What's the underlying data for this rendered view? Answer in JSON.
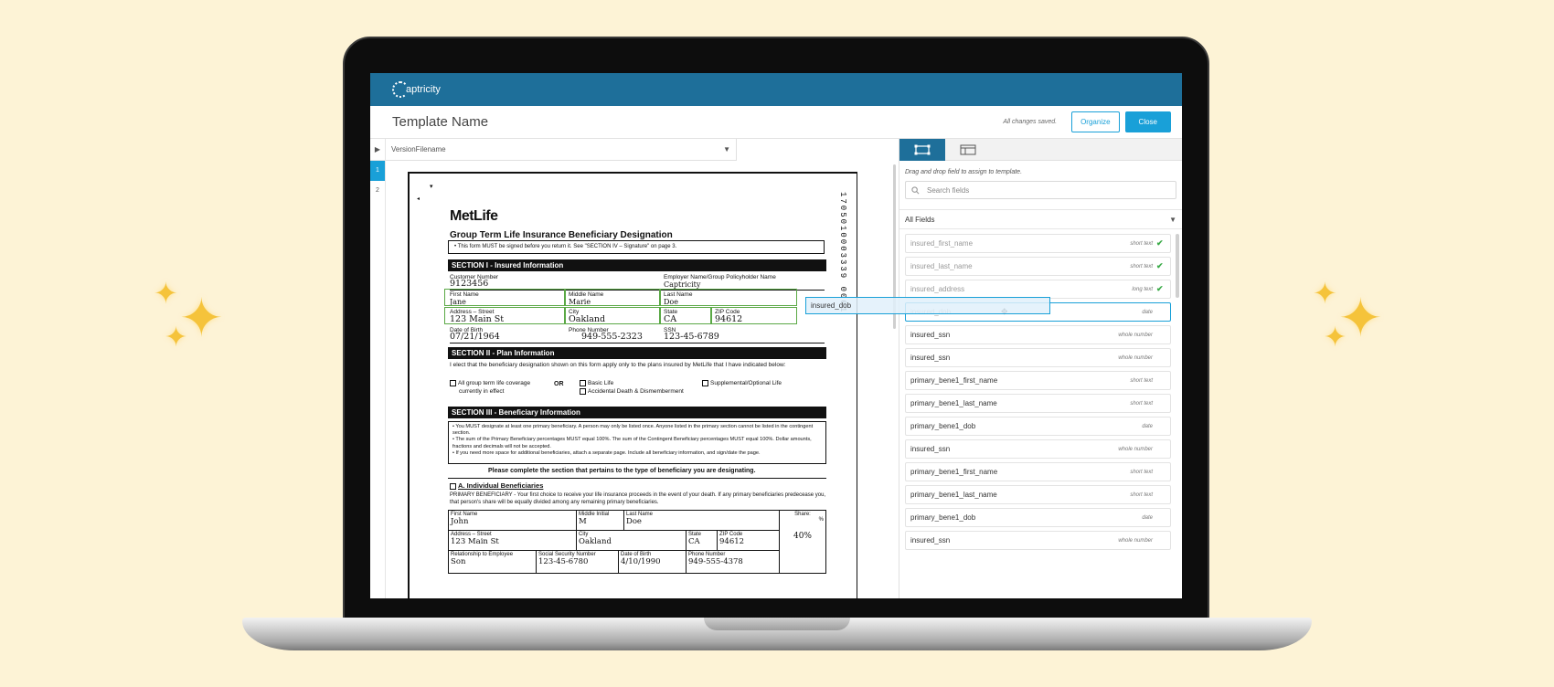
{
  "app": {
    "logo_text": "aptricity",
    "page_title": "Template Name",
    "save_status": "All changes saved.",
    "organize_label": "Organize",
    "close_label": "Close"
  },
  "document": {
    "version_filename": "VersionFilename",
    "pages": [
      "1",
      "2"
    ],
    "active_page": "1",
    "barcode": "1705010003339 0001",
    "form": {
      "company": "MetLife",
      "title": "Group Term Life Insurance Beneficiary Designation",
      "notice": "• This form MUST be signed before you return it. See \"SECTION IV – Signature\" on page 3.",
      "section1": "SECTION I - Insured Information",
      "customer_number_label": "Customer Number",
      "customer_number": "9123456",
      "employer_label": "Employer Name/Group Policyholder Name",
      "employer": "Captricity",
      "first_name_label": "First Name",
      "first_name": "Jane",
      "middle_name_label": "Middle Name",
      "middle_name": "Marie",
      "last_name_label": "Last Name",
      "last_name": "Doe",
      "address_label": "Address – Street",
      "address": "123 Main St",
      "city_label": "City",
      "city": "Oakland",
      "state_label": "State",
      "state": "CA",
      "zip_label": "ZIP Code",
      "zip": "94612",
      "dob_label": "Date of Birth",
      "dob": "07/21/1964",
      "phone_label": "Phone Number",
      "phone": "949-555-2323",
      "ssn_label": "SSN",
      "ssn": "123-45-6789",
      "section2": "SECTION II - Plan Information",
      "plan_text": "I elect that the beneficiary designation shown on this form apply only to the plans insured by MetLife that I have indicated below:",
      "opt_group": "All group term life coverage",
      "opt_group2": "currently in effect",
      "or": "OR",
      "opt_basic": "Basic Life",
      "opt_add": "Accidental Death & Dismemberment",
      "opt_supp": "Supplemental/Optional Life",
      "section3": "SECTION III - Beneficiary Information",
      "bullet1": "• You MUST designate at least one primary beneficiary. A person may only be listed once. Anyone listed in the primary section cannot be listed in the contingent section.",
      "bullet2": "• The sum of the Primary Beneficiary percentages MUST equal 100%. The sum of the Contingent Beneficiary percentages MUST equal 100%. Dollar amounts, fractions and decimals will not be accepted.",
      "bullet3": "• If you need more space for additional beneficiaries, attach a separate page. Include all beneficiary information, and sign/date the page.",
      "complete_note": "Please complete the section that pertains to the type of beneficiary you are designating.",
      "individual_head": "A. Individual Beneficiaries",
      "primary_text": "PRIMARY BENEFICIARY - Your first choice to receive your life insurance proceeds in the event of your death. If any primary beneficiaries predecease you, that person's share will be equally divided among any remaining primary beneficiaries.",
      "b_first_label": "First Name",
      "b_first": "John",
      "b_mi_label": "Middle Initial",
      "b_mi": "M",
      "b_last_label": "Last Name",
      "b_last": "Doe",
      "b_share_label": "Share:",
      "b_share_pct": "%",
      "b_share": "40%",
      "b_addr_label": "Address – Street",
      "b_addr": "123 Main St",
      "b_city_label": "City",
      "b_city": "Oakland",
      "b_state_label": "State",
      "b_state": "CA",
      "b_zip_label": "ZIP Code",
      "b_zip": "94612",
      "b_rel_label": "Relationship to Employee",
      "b_rel": "Son",
      "b_ssn_label": "Social Security Number",
      "b_ssn": "123-45-6780",
      "b_dob_label": "Date of Birth",
      "b_dob": "4/10/1990",
      "b_phone_label": "Phone Number",
      "b_phone": "949-555-4378"
    }
  },
  "drag_chip": {
    "label": "insured_dob"
  },
  "panel": {
    "hint": "Drag and drop field to assign to template.",
    "search_placeholder": "Search fields",
    "filter_label": "All Fields",
    "fields": [
      {
        "name": "insured_first_name",
        "type": "short text",
        "check": "✔"
      },
      {
        "name": "insured_last_name",
        "type": "short text",
        "check": "✔"
      },
      {
        "name": "insured_address",
        "type": "long text",
        "check": "✔"
      },
      {
        "name": "insured_dob",
        "type": "date",
        "check": ""
      },
      {
        "name": "insured_ssn",
        "type": "whole number",
        "check": ""
      },
      {
        "name": "insured_ssn",
        "type": "whole number",
        "check": ""
      },
      {
        "name": "primary_bene1_first_name",
        "type": "short text",
        "check": ""
      },
      {
        "name": "primary_bene1_last_name",
        "type": "short text",
        "check": ""
      },
      {
        "name": "primary_bene1_dob",
        "type": "date",
        "check": ""
      },
      {
        "name": "insured_ssn",
        "type": "whole number",
        "check": ""
      },
      {
        "name": "primary_bene1_first_name",
        "type": "short text",
        "check": ""
      },
      {
        "name": "primary_bene1_last_name",
        "type": "short text",
        "check": ""
      },
      {
        "name": "primary_bene1_dob",
        "type": "date",
        "check": ""
      },
      {
        "name": "insured_ssn",
        "type": "whole number",
        "check": ""
      }
    ]
  },
  "colors": {
    "brand": "#1e6f9a",
    "accent": "#19a0d8",
    "assigned_box": "#5aa845",
    "check": "#3cab49",
    "background": "#fdf3d6"
  }
}
